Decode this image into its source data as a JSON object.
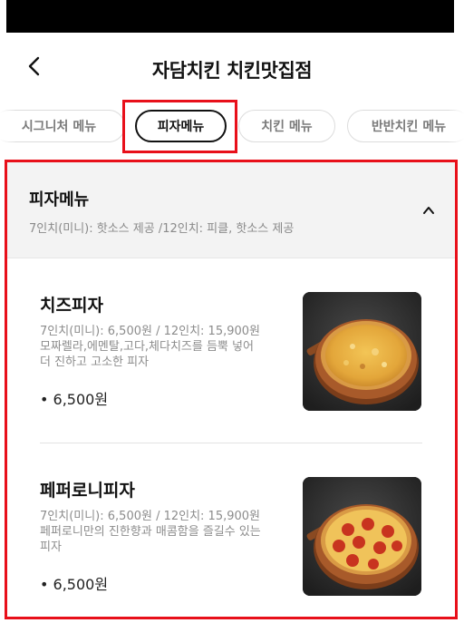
{
  "header": {
    "title": "자담치킨  치킨맛집점"
  },
  "tabs": [
    {
      "label": "시그니처 메뉴"
    },
    {
      "label": "피자메뉴"
    },
    {
      "label": "치킨 메뉴"
    },
    {
      "label": "반반치킨 메뉴"
    }
  ],
  "category": {
    "title": "피자메뉴",
    "description": "7인치(미니): 핫소스 제공 /12인치: 피클, 핫소스 제공"
  },
  "items": [
    {
      "name": "치즈피자",
      "desc_line1": "7인치(미니): 6,500원 / 12인치: 15,900원",
      "desc_line2": "모짜렐라,에멘탈,고다,체다치즈를 듬뿍 넣어",
      "desc_line3": "더 진하고 고소한 피자",
      "price": "• 6,500원",
      "image": "cheese-pizza"
    },
    {
      "name": "페퍼로니피자",
      "desc_line1": "7인치(미니): 6,500원 / 12인치: 15,900원",
      "desc_line2": "페퍼로니만의 진한향과 매콤함을 즐길수 있는",
      "desc_line3": "피자",
      "price": "• 6,500원",
      "image": "pepperoni-pizza"
    }
  ],
  "colors": {
    "highlight": "#e8101a",
    "section_bg": "#f3f3f3"
  }
}
